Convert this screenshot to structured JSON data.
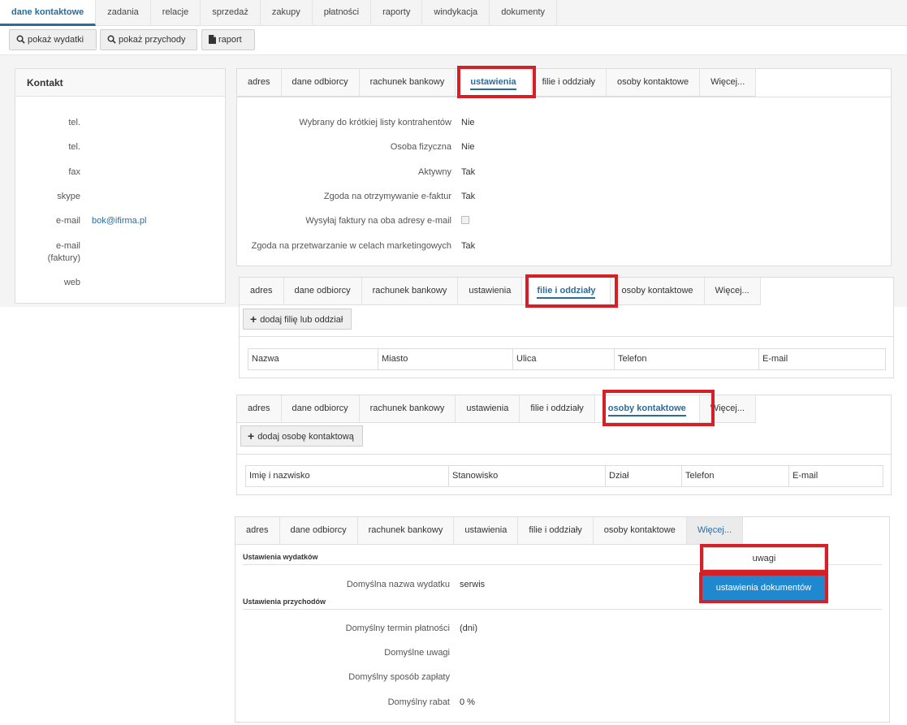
{
  "topnav": [
    "dane kontaktowe",
    "zadania",
    "relacje",
    "sprzedaż",
    "zakupy",
    "płatności",
    "raporty",
    "windykacja",
    "dokumenty"
  ],
  "toolbar": {
    "expenses": "pokaż wydatki",
    "income": "pokaż przychody",
    "report": "raport"
  },
  "contact": {
    "title": "Kontakt",
    "rows": [
      {
        "label": "tel.",
        "value": ""
      },
      {
        "label": "tel.",
        "value": ""
      },
      {
        "label": "fax",
        "value": ""
      },
      {
        "label": "skype",
        "value": ""
      },
      {
        "label": "e-mail",
        "value": "bok@ifirma.pl"
      },
      {
        "label": "e-mail (faktury)",
        "value": ""
      },
      {
        "label": "web",
        "value": ""
      }
    ]
  },
  "tabs": [
    "adres",
    "dane odbiorcy",
    "rachunek bankowy",
    "ustawienia",
    "filie i oddziały",
    "osoby kontaktowe",
    "Więcej..."
  ],
  "settings": [
    {
      "label": "Wybrany do krótkiej listy kontrahentów",
      "value": "Nie"
    },
    {
      "label": "Osoba fizyczna",
      "value": "Nie"
    },
    {
      "label": "Aktywny",
      "value": "Tak"
    },
    {
      "label": "Zgoda na otrzymywanie e-faktur",
      "value": "Tak"
    },
    {
      "label": "Wysyłaj faktury na oba adresy e-mail",
      "value": ""
    },
    {
      "label": "Zgoda na przetwarzanie w celach marketingowych",
      "value": "Tak"
    }
  ],
  "branches": {
    "add_button": "dodaj filię lub oddział",
    "columns": [
      "Nazwa",
      "Miasto",
      "Ulica",
      "Telefon",
      "E-mail"
    ]
  },
  "persons": {
    "add_button": "dodaj osobę kontaktową",
    "columns": [
      "Imię i nazwisko",
      "Stanowisko",
      "Dział",
      "Telefon",
      "E-mail"
    ]
  },
  "more": {
    "expenses_header": "Ustawienia wydatków",
    "expense_name_label": "Domyślna nazwa wydatku",
    "expense_name_value": "serwis",
    "income_header": "Ustawienia przychodów",
    "rows": [
      {
        "label": "Domyślny termin płatności",
        "value": "(dni)"
      },
      {
        "label": "Domyślne uwagi",
        "value": ""
      },
      {
        "label": "Domyślny sposób zapłaty",
        "value": ""
      },
      {
        "label": "Domyślny rabat",
        "value": "0 %"
      }
    ],
    "dropdown_item": "uwagi",
    "dropdown_button": "ustawienia dokumentów"
  },
  "colors": {
    "accent": "#2b6c9e",
    "button_blue": "#1f88cf",
    "highlight_red": "#d42027"
  }
}
